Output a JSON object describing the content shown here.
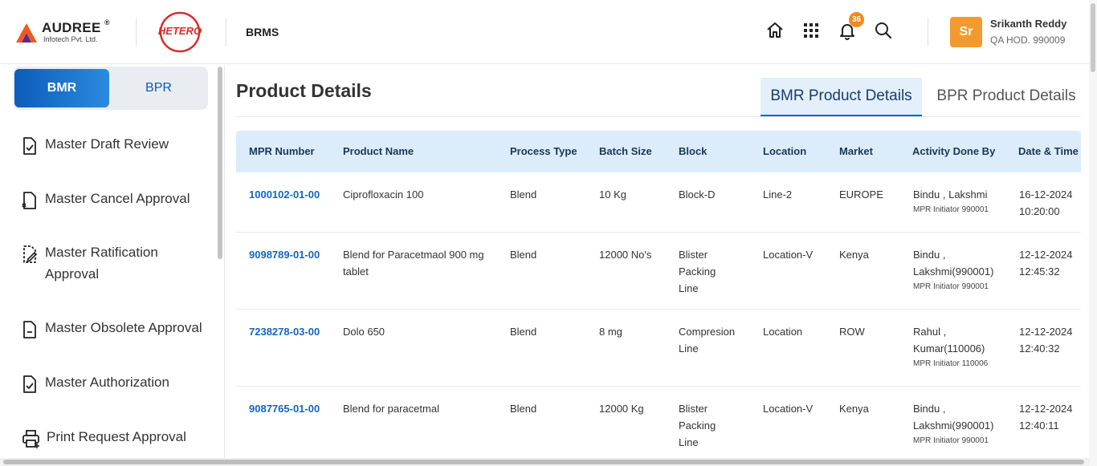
{
  "header": {
    "brand_name": "AUDREE",
    "brand_reg": "®",
    "brand_sub": "Infotech Pvt. Ltd.",
    "partner_logo_text": "HETERO",
    "app_name": "BRMS",
    "notification_count": "36",
    "user": {
      "initials": "Sr",
      "name": "Srikanth Reddy",
      "role": "QA HOD. 990009"
    }
  },
  "sidebar": {
    "toggle": {
      "active": "BMR",
      "inactive": "BPR"
    },
    "items": [
      {
        "label": "Master Draft Review",
        "icon": "doc-check-icon"
      },
      {
        "label": "Master Cancel Approval",
        "icon": "doc-cancel-icon"
      },
      {
        "label": "Master Ratification Approval",
        "icon": "doc-edit-icon"
      },
      {
        "label": "Master Obsolete Approval",
        "icon": "doc-minus-icon"
      },
      {
        "label": "Master Authorization",
        "icon": "doc-check-icon"
      },
      {
        "label": "Print Request Approval",
        "icon": "printer-icon"
      }
    ]
  },
  "main": {
    "title": "Product Details",
    "tabs": [
      {
        "label": "BMR Product Details",
        "active": true
      },
      {
        "label": "BPR Product Details",
        "active": false
      }
    ],
    "table": {
      "columns": [
        "MPR Number",
        "Product Name",
        "Process Type",
        "Batch Size",
        "Block",
        "Location",
        "Market",
        "Activity Done By",
        "Date & Time"
      ],
      "rows": [
        {
          "mpr": "1000102-01-00",
          "product": "Ciprofloxacin 100",
          "process": "Blend",
          "batch": "10 Kg",
          "block": "Block-D",
          "location": "Line-2",
          "market": "EUROPE",
          "activity": "Bindu , Lakshmi",
          "activity_sub": "MPR Initiator 990001",
          "date": "16-12-2024",
          "time": "10:20:00"
        },
        {
          "mpr": "9098789-01-00",
          "product": "Blend for Paracetmaol 900 mg tablet",
          "process": "Blend",
          "batch": "12000 No's",
          "block": "Blister Packing Line",
          "location": "Location-V",
          "market": "Kenya",
          "activity": "Bindu , Lakshmi(990001)",
          "activity_sub": "MPR Initiator 990001",
          "date": "12-12-2024",
          "time": "12:45:32"
        },
        {
          "mpr": "7238278-03-00",
          "product": "Dolo 650",
          "process": "Blend",
          "batch": "8 mg",
          "block": "Compresion Line",
          "location": "Location",
          "market": "ROW",
          "activity": "Rahul , Kumar(110006)",
          "activity_sub": "MPR Initiator 110006",
          "date": "12-12-2024",
          "time": "12:40:32"
        },
        {
          "mpr": "9087765-01-00",
          "product": "Blend for paracetmal",
          "process": "Blend",
          "batch": "12000 Kg",
          "block": "Blister Packing Line",
          "location": "Location-V",
          "market": "Kenya",
          "activity": "Bindu , Lakshmi(990001)",
          "activity_sub": "MPR Initiator 990001",
          "date": "12-12-2024",
          "time": "12:40:11"
        }
      ]
    }
  },
  "colors": {
    "accent": "#1565c0",
    "header_bg": "#dcecfb",
    "badge": "#f08a1c",
    "avatar": "#f29a2e"
  }
}
